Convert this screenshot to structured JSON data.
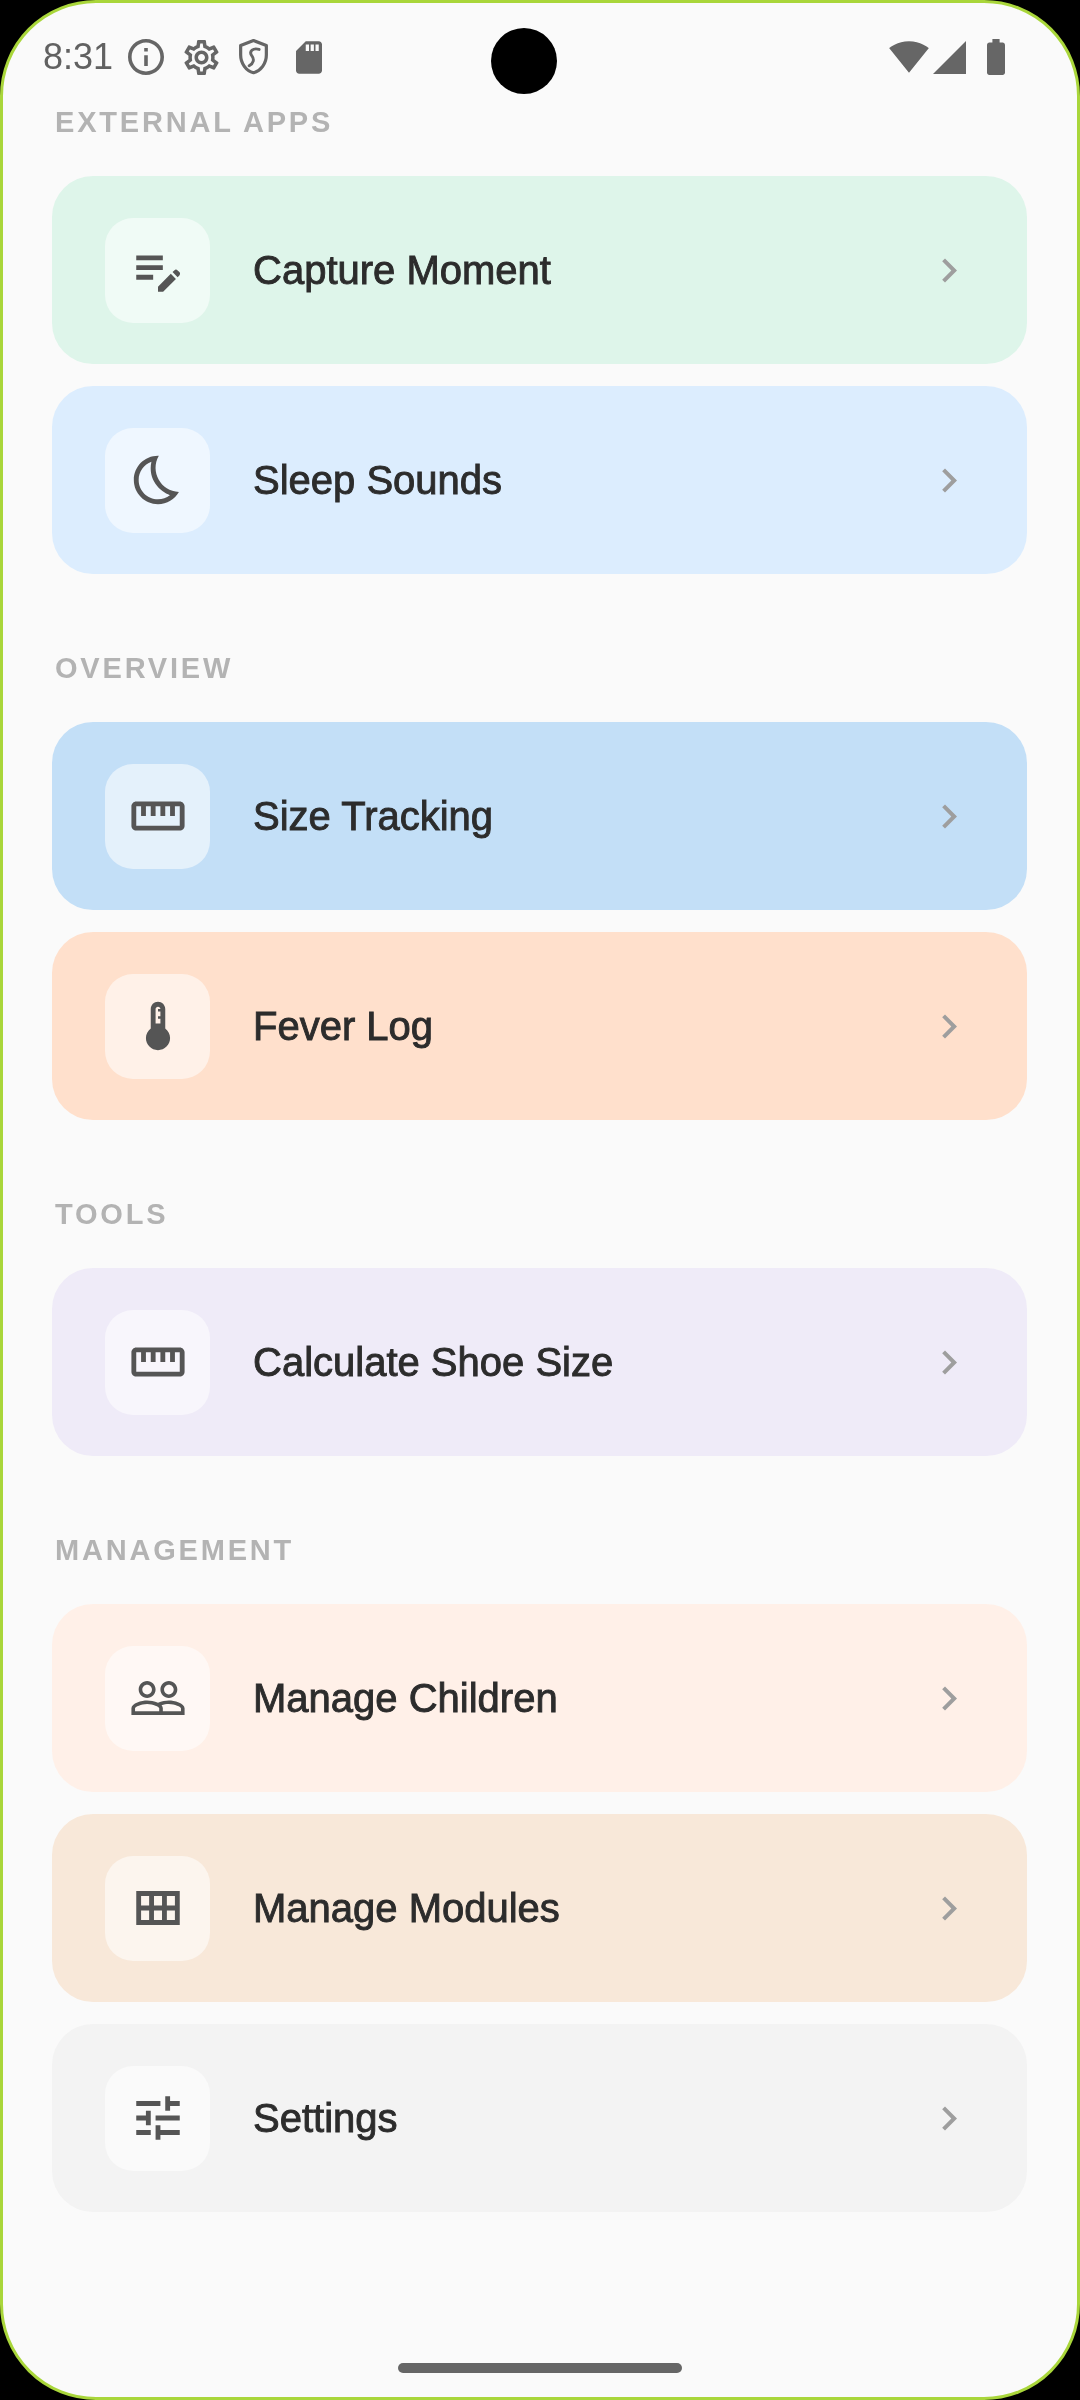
{
  "status_bar": {
    "time": "8:31"
  },
  "sections": [
    {
      "heading": "EXTERNAL APPS",
      "items": [
        {
          "label": "Capture Moment",
          "color": "#def5ea"
        },
        {
          "label": "Sleep Sounds",
          "color": "#dcedfe"
        }
      ]
    },
    {
      "heading": "OVERVIEW",
      "items": [
        {
          "label": "Size Tracking",
          "color": "#c3dff7"
        },
        {
          "label": "Fever Log",
          "color": "#ffe0cc"
        }
      ]
    },
    {
      "heading": "TOOLS",
      "items": [
        {
          "label": "Calculate Shoe Size",
          "color": "#efebf8"
        }
      ]
    },
    {
      "heading": "MANAGEMENT",
      "items": [
        {
          "label": "Manage Children",
          "color": "#fff0e8"
        },
        {
          "label": "Manage Modules",
          "color": "#f8e8d9"
        },
        {
          "label": "Settings",
          "color": "#f3f3f3"
        }
      ]
    }
  ]
}
